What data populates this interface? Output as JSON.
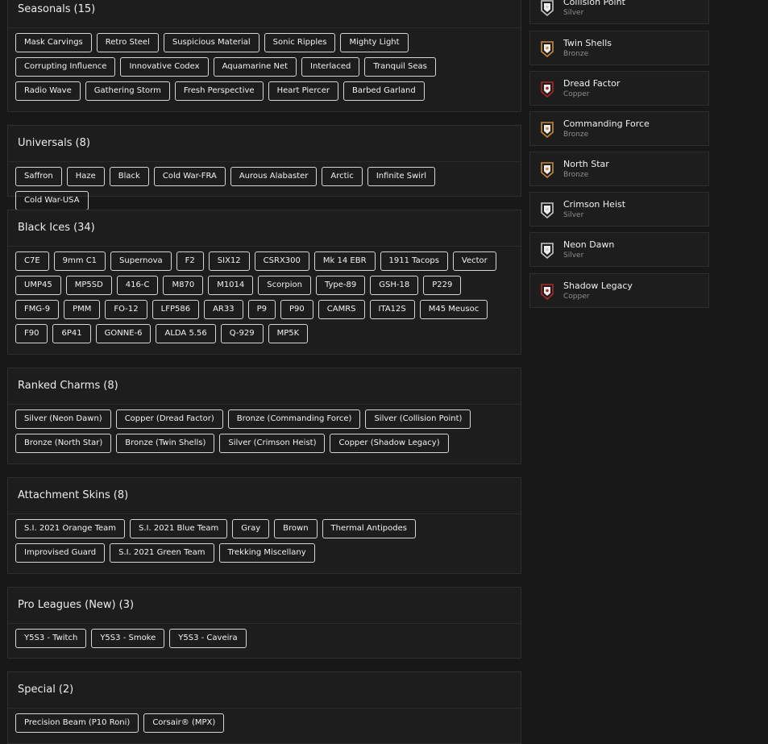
{
  "sections": [
    {
      "title": "Seasonals",
      "count": "(15)",
      "items": [
        "Mask Carvings",
        "Retro Steel",
        "Suspicious Material",
        "Sonic Ripples",
        "Mighty Light",
        "Corrupting Influence",
        "Innovative Codex",
        "Aquamarine Net",
        "Interlaced",
        "Tranquil Seas",
        "Radio Wave",
        "Gathering Storm",
        "Fresh Perspective",
        "Heart Piercer",
        "Barbed Garland"
      ]
    },
    {
      "title": "Universals",
      "count": "(8)",
      "items": [
        "Saffron",
        "Haze",
        "Black",
        "Cold War-FRA",
        "Aurous Alabaster",
        "Arctic",
        "Infinite Swirl",
        "Cold War-USA"
      ]
    },
    {
      "title": "Black Ices",
      "count": "(34)",
      "items": [
        "C7E",
        "9mm C1",
        "Supernova",
        "F2",
        "SIX12",
        "CSRX300",
        "Mk 14 EBR",
        "1911 Tacops",
        "Vector",
        "UMP45",
        "MP5SD",
        "416-C",
        "M870",
        "M1014",
        "Scorpion",
        "Type-89",
        "GSH-18",
        "P229",
        "FMG-9",
        "PMM",
        "FO-12",
        "LFP586",
        "AR33",
        "P9",
        "P90",
        "CAMRS",
        "ITA12S",
        "M45 Meusoc",
        "F90",
        "6P41",
        "GONNE-6",
        "ALDA 5.56",
        "Q-929",
        "MP5K"
      ]
    },
    {
      "title": "Ranked Charms",
      "count": "(8)",
      "items": [
        "Silver (Neon Dawn)",
        "Copper (Dread Factor)",
        "Bronze (Commanding Force)",
        "Silver (Collision Point)",
        "Bronze (North Star)",
        "Bronze (Twin Shells)",
        "Silver (Crimson Heist)",
        "Copper (Shadow Legacy)"
      ]
    },
    {
      "title": "Attachment Skins",
      "count": "(8)",
      "items": [
        "S.I. 2021 Orange Team",
        "S.I. 2021 Blue Team",
        "Gray",
        "Brown",
        "Thermal Antipodes",
        "Improvised Guard",
        "S.I. 2021 Green Team",
        "Trekking Miscellany"
      ]
    },
    {
      "title": "Pro Leagues (New)",
      "count": "(3)",
      "items": [
        "Y5S3 - Twitch",
        "Y5S3 - Smoke",
        "Y5S3 - Caveira"
      ]
    },
    {
      "title": "Special",
      "count": "(2)",
      "items": [
        "Precision Beam (P10 Roni)",
        "Corsair® (MPX)"
      ]
    }
  ],
  "sidebar": [
    {
      "name": "Collision Point",
      "tier": "Silver",
      "icon": "silver-charm-icon",
      "color": "#c8c8c8"
    },
    {
      "name": "Twin Shells",
      "tier": "Bronze",
      "icon": "bronze-charm-icon",
      "color": "#c98a3a"
    },
    {
      "name": "Dread Factor",
      "tier": "Copper",
      "icon": "copper-charm-icon",
      "color": "#b0262b"
    },
    {
      "name": "Commanding Force",
      "tier": "Bronze",
      "icon": "bronze-charm-icon",
      "color": "#c98a3a"
    },
    {
      "name": "North Star",
      "tier": "Bronze",
      "icon": "bronze-charm-icon",
      "color": "#c98a3a"
    },
    {
      "name": "Crimson Heist",
      "tier": "Silver",
      "icon": "silver-charm-icon",
      "color": "#c8c8c8"
    },
    {
      "name": "Neon Dawn",
      "tier": "Silver",
      "icon": "silver-charm-icon",
      "color": "#c8c8c8"
    },
    {
      "name": "Shadow Legacy",
      "tier": "Copper",
      "icon": "copper-charm-icon",
      "color": "#b0262b"
    }
  ]
}
